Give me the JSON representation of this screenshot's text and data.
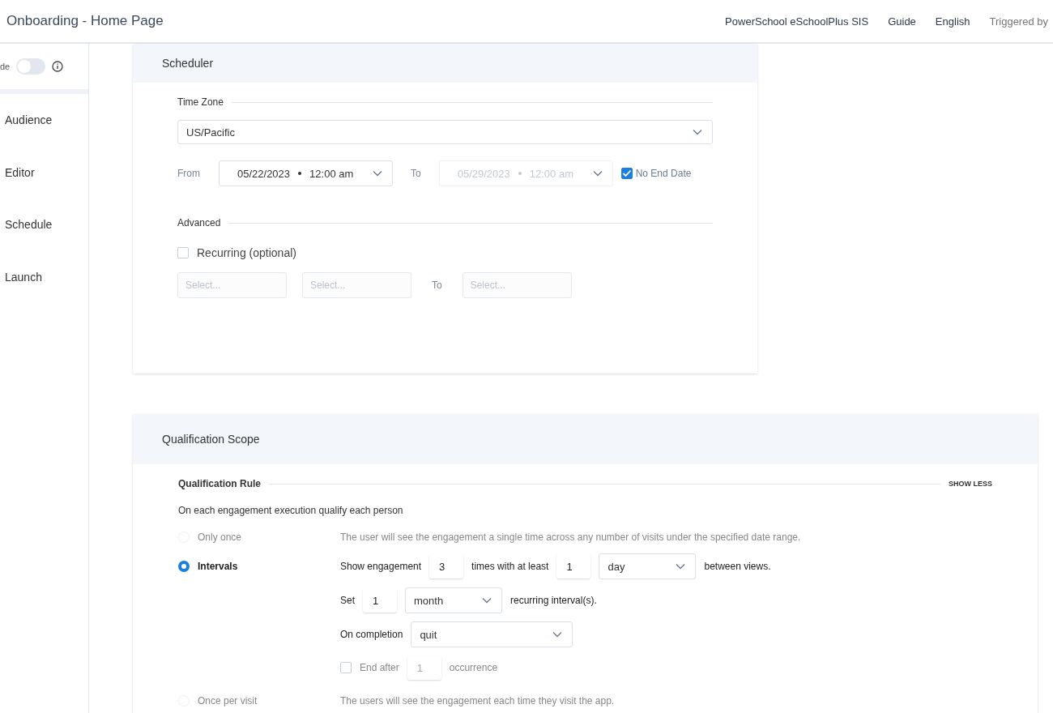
{
  "header": {
    "title": "Onboarding - Home Page",
    "links": [
      "PowerSchool eSchoolPlus SIS",
      "Guide",
      "English",
      "Triggered by"
    ]
  },
  "sidebar": {
    "toggle_label": "de",
    "toggle": {
      "on": false
    },
    "items": [
      "Audience",
      "Editor",
      "Schedule",
      "Launch"
    ]
  },
  "scheduler": {
    "title": "Scheduler",
    "time_zone_label": "Time Zone",
    "time_zone": "US/Pacific",
    "from_label": "From",
    "from": {
      "date": "05/22/2023",
      "time": "12:00 am",
      "disabled": false
    },
    "to_label": "To",
    "to": {
      "date": "05/29/2023",
      "time": "12:00 am",
      "disabled": true
    },
    "no_end_date": {
      "label": "No End Date",
      "checked": true
    },
    "advanced_label": "Advanced",
    "recurring": {
      "label": "Recurring (optional)",
      "checked": false
    },
    "selects": [
      {
        "placeholder": "Select..."
      },
      {
        "placeholder": "Select..."
      }
    ],
    "to_select_label": "To",
    "to_select": {
      "placeholder": "Select..."
    }
  },
  "qualification": {
    "title": "Qualification Scope",
    "rule_label": "Qualification Rule",
    "toggle_link": "SHOW LESS",
    "intro": "On each engagement execution qualify each person",
    "options": [
      {
        "label": "Only once",
        "selected": false,
        "kind": "text",
        "description": "The user will see the engagement a single time across any number of visits under the specified date range."
      },
      {
        "label": "Intervals",
        "selected": true,
        "kind": "intervals"
      },
      {
        "label": "Once per visit",
        "selected": false,
        "kind": "text",
        "description": "The users will see the engagement each time they visit the app."
      }
    ],
    "intervals": {
      "show_label": "Show engagement",
      "times": "3",
      "times_label": "times with at least",
      "gap": "1",
      "gap_unit": "day",
      "between_label": "between views.",
      "set_label": "Set",
      "set_count": "1",
      "set_unit": "month",
      "recurring_label": "recurring interval(s).",
      "completion_label": "On completion",
      "completion": "quit",
      "end_after": {
        "label": "End after",
        "checked": false,
        "count": "1",
        "unit_label": "occurrence"
      }
    }
  }
}
